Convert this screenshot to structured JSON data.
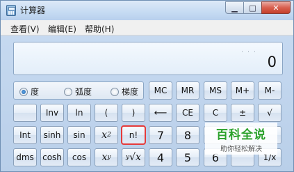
{
  "window": {
    "title": "计算器"
  },
  "controls": {
    "minimize": "▁",
    "maximize": "□",
    "close": "✕"
  },
  "menu": [
    "查看(V)",
    "编辑(E)",
    "帮助(H)"
  ],
  "display": {
    "value": "0"
  },
  "angle_modes": [
    {
      "label": "度",
      "checked": true
    },
    {
      "label": "弧度",
      "checked": false
    },
    {
      "label": "梯度",
      "checked": false
    }
  ],
  "memory": [
    "MC",
    "MR",
    "MS",
    "M+",
    "M-"
  ],
  "rows": {
    "r1": [
      "",
      "Inv",
      "ln",
      "(",
      ")",
      "⟵",
      "CE",
      "C",
      "±",
      "√"
    ],
    "r2": [
      "Int",
      "sinh",
      "sin",
      "n!",
      "7",
      "8"
    ],
    "r3": [
      "dms",
      "cosh",
      "cos",
      "4",
      "5",
      "6",
      "1/x"
    ]
  },
  "watermark": {
    "title": "百科全说",
    "subtitle": "助你轻松解决"
  },
  "colors": {
    "highlight": "#e53a3a",
    "watermark_green": "#2aa12a"
  }
}
